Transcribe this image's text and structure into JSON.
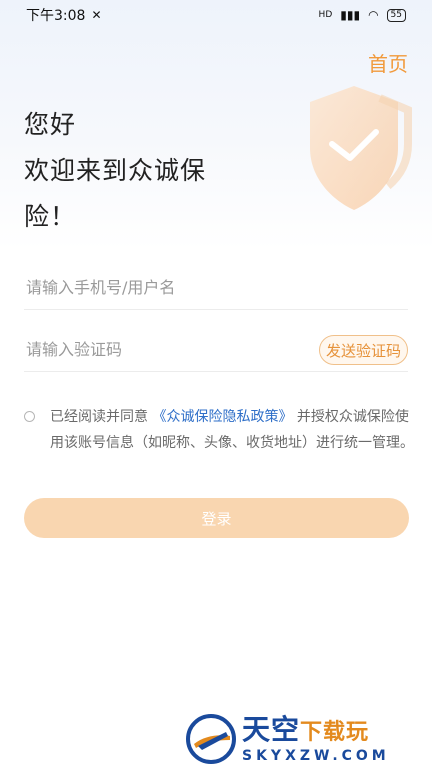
{
  "statusbar": {
    "time": "下午3:08",
    "signal": "HD",
    "battery": "55"
  },
  "header": {
    "home_label": "首页"
  },
  "greeting": {
    "line1": "您好",
    "line2": "欢迎来到众诚保",
    "line3": "险！"
  },
  "form": {
    "phone_placeholder": "请输入手机号/用户名",
    "code_placeholder": "请输入验证码",
    "send_code_label": "发送验证码"
  },
  "agreement": {
    "prefix": "已经阅读并同意 ",
    "policy": "《众诚保险隐私政策》",
    "suffix": "并授权众诚保险使用该账号信息（如昵称、头像、收货地址）进行统一管理。"
  },
  "login": {
    "label": "登录"
  },
  "watermark": {
    "title_main": "天空",
    "title_accent": "下载玩",
    "subtitle": "SKYXZW.COM"
  },
  "colors": {
    "accent": "#f19a3c",
    "link": "#2f6fc8",
    "button_bg": "#f9d6b0"
  }
}
